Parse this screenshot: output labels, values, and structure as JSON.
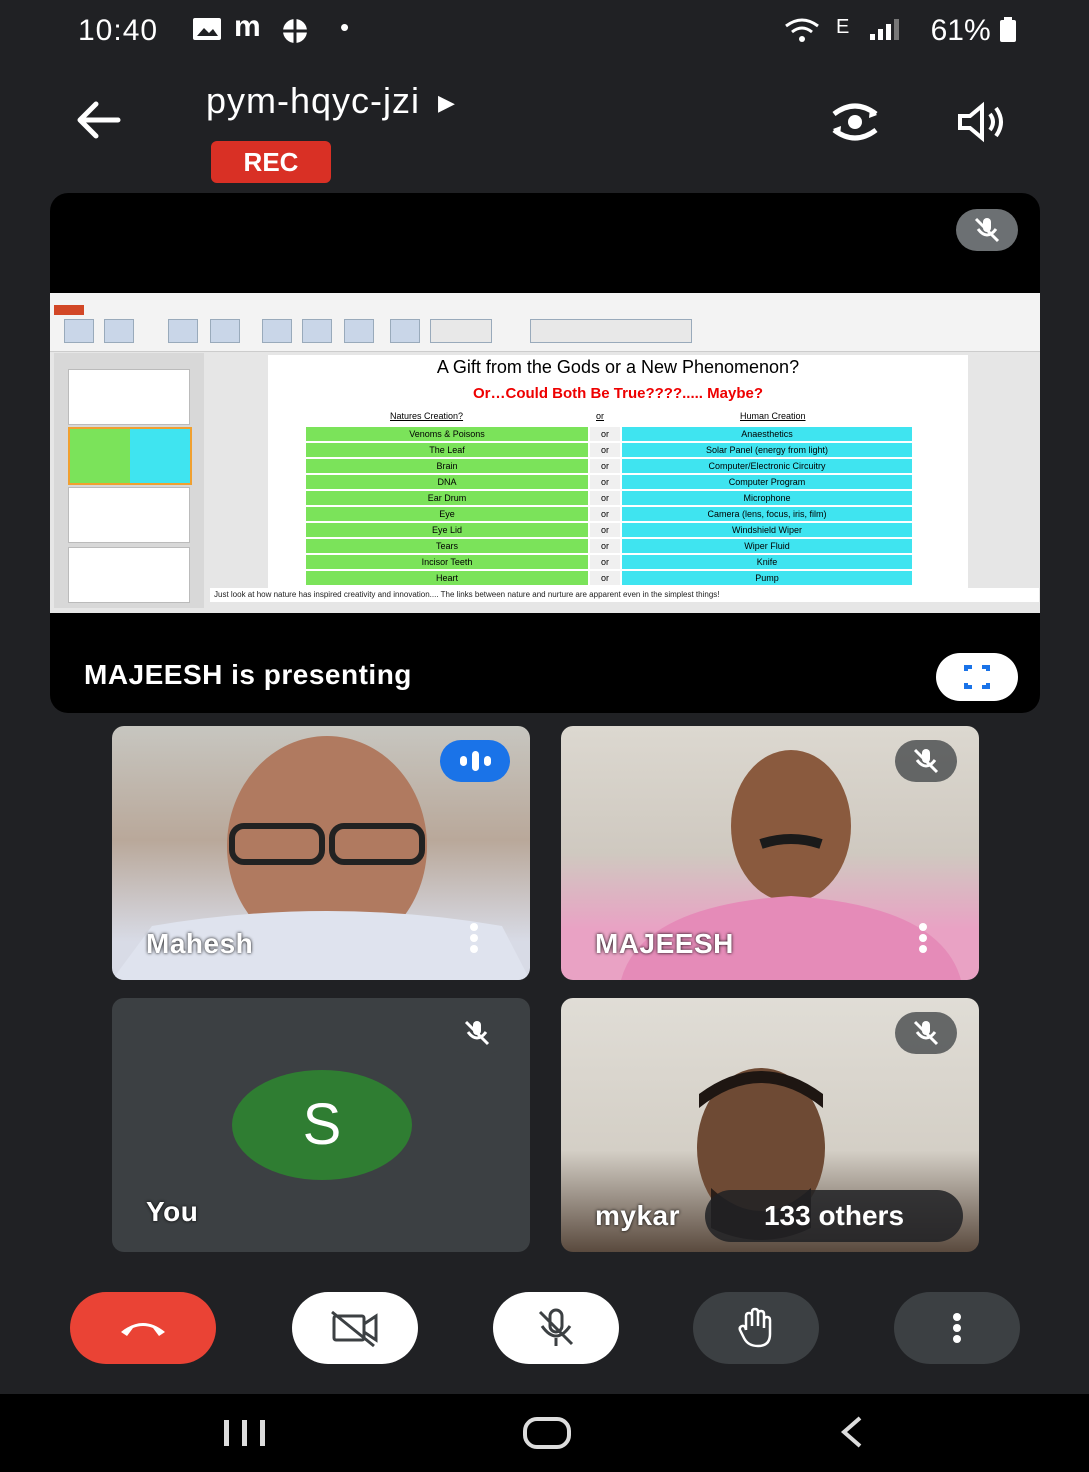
{
  "status_bar": {
    "time": "10:40",
    "notif_icons": [
      "gallery-icon",
      "m-icon",
      "globe-icon",
      "dot-icon"
    ],
    "battery_text": "61%"
  },
  "header": {
    "meeting_code": "pym-hqyc-jzi",
    "rec_label": "REC",
    "icons": [
      "back-arrow-icon",
      "switch-camera-icon",
      "speaker-icon"
    ]
  },
  "presentation": {
    "presenter_label": "MAJEESH is presenting",
    "slide": {
      "title": "A Gift from the Gods or a New Phenomenon?",
      "subtitle": "Or…Could Both Be True????.....   Maybe?",
      "left_header": "Natures Creation?",
      "mid_header": "or",
      "right_header": "Human Creation",
      "rows": [
        {
          "nature": "Venoms & Poisons",
          "or": "or",
          "human": "Anaesthetics"
        },
        {
          "nature": "The Leaf",
          "or": "or",
          "human": "Solar Panel (energy from light)"
        },
        {
          "nature": "Brain",
          "or": "or",
          "human": "Computer/Electronic Circuitry"
        },
        {
          "nature": "DNA",
          "or": "or",
          "human": "Computer Program"
        },
        {
          "nature": "Ear Drum",
          "or": "or",
          "human": "Microphone"
        },
        {
          "nature": "Eye",
          "or": "or",
          "human": "Camera (lens, focus, iris, film)"
        },
        {
          "nature": "Eye Lid",
          "or": "or",
          "human": "Windshield Wiper"
        },
        {
          "nature": "Tears",
          "or": "or",
          "human": "Wiper Fluid"
        },
        {
          "nature": "Incisor Teeth",
          "or": "or",
          "human": "Knife"
        },
        {
          "nature": "Heart",
          "or": "or",
          "human": "Pump"
        }
      ],
      "notes": "Just look at how nature has inspired creativity and innovation.... The links between nature and nurture are apparent even in the simplest things!"
    }
  },
  "participants": [
    {
      "name": "Mahesh",
      "state": "speaking"
    },
    {
      "name": "MAJEESH",
      "state": "muted"
    },
    {
      "name": "You",
      "avatar_letter": "S",
      "avatar_color": "#2f7d32",
      "state": "muted"
    },
    {
      "name": "mykar",
      "state": "muted"
    }
  ],
  "others_label": "133 others",
  "controls": {
    "end_call_color": "#ea4335",
    "buttons": [
      "end-call",
      "camera-off",
      "mic-off",
      "raise-hand",
      "more-options"
    ]
  }
}
